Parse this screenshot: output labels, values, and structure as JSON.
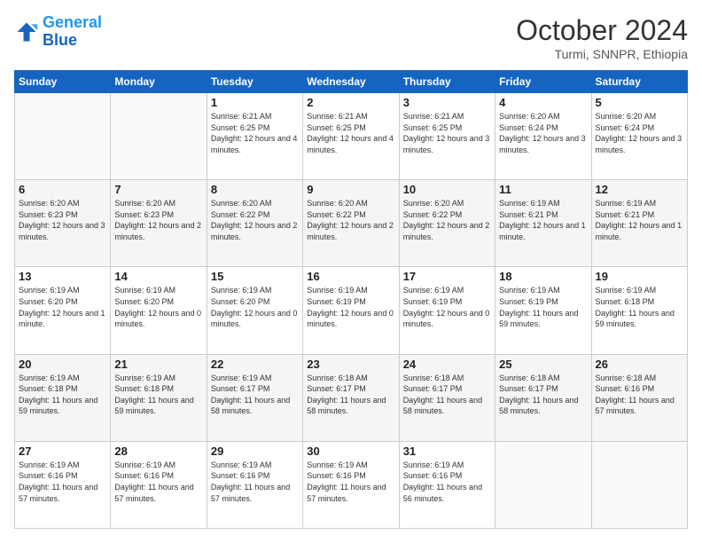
{
  "logo": {
    "line1": "General",
    "line2": "Blue"
  },
  "title": "October 2024",
  "location": "Turmi, SNNPR, Ethiopia",
  "weekdays": [
    "Sunday",
    "Monday",
    "Tuesday",
    "Wednesday",
    "Thursday",
    "Friday",
    "Saturday"
  ],
  "weeks": [
    [
      {
        "day": "",
        "info": ""
      },
      {
        "day": "",
        "info": ""
      },
      {
        "day": "1",
        "info": "Sunrise: 6:21 AM\nSunset: 6:25 PM\nDaylight: 12 hours\nand 4 minutes."
      },
      {
        "day": "2",
        "info": "Sunrise: 6:21 AM\nSunset: 6:25 PM\nDaylight: 12 hours\nand 4 minutes."
      },
      {
        "day": "3",
        "info": "Sunrise: 6:21 AM\nSunset: 6:25 PM\nDaylight: 12 hours\nand 3 minutes."
      },
      {
        "day": "4",
        "info": "Sunrise: 6:20 AM\nSunset: 6:24 PM\nDaylight: 12 hours\nand 3 minutes."
      },
      {
        "day": "5",
        "info": "Sunrise: 6:20 AM\nSunset: 6:24 PM\nDaylight: 12 hours\nand 3 minutes."
      }
    ],
    [
      {
        "day": "6",
        "info": "Sunrise: 6:20 AM\nSunset: 6:23 PM\nDaylight: 12 hours\nand 3 minutes."
      },
      {
        "day": "7",
        "info": "Sunrise: 6:20 AM\nSunset: 6:23 PM\nDaylight: 12 hours\nand 2 minutes."
      },
      {
        "day": "8",
        "info": "Sunrise: 6:20 AM\nSunset: 6:22 PM\nDaylight: 12 hours\nand 2 minutes."
      },
      {
        "day": "9",
        "info": "Sunrise: 6:20 AM\nSunset: 6:22 PM\nDaylight: 12 hours\nand 2 minutes."
      },
      {
        "day": "10",
        "info": "Sunrise: 6:20 AM\nSunset: 6:22 PM\nDaylight: 12 hours\nand 2 minutes."
      },
      {
        "day": "11",
        "info": "Sunrise: 6:19 AM\nSunset: 6:21 PM\nDaylight: 12 hours\nand 1 minute."
      },
      {
        "day": "12",
        "info": "Sunrise: 6:19 AM\nSunset: 6:21 PM\nDaylight: 12 hours\nand 1 minute."
      }
    ],
    [
      {
        "day": "13",
        "info": "Sunrise: 6:19 AM\nSunset: 6:20 PM\nDaylight: 12 hours\nand 1 minute."
      },
      {
        "day": "14",
        "info": "Sunrise: 6:19 AM\nSunset: 6:20 PM\nDaylight: 12 hours\nand 0 minutes."
      },
      {
        "day": "15",
        "info": "Sunrise: 6:19 AM\nSunset: 6:20 PM\nDaylight: 12 hours\nand 0 minutes."
      },
      {
        "day": "16",
        "info": "Sunrise: 6:19 AM\nSunset: 6:19 PM\nDaylight: 12 hours\nand 0 minutes."
      },
      {
        "day": "17",
        "info": "Sunrise: 6:19 AM\nSunset: 6:19 PM\nDaylight: 12 hours\nand 0 minutes."
      },
      {
        "day": "18",
        "info": "Sunrise: 6:19 AM\nSunset: 6:19 PM\nDaylight: 11 hours\nand 59 minutes."
      },
      {
        "day": "19",
        "info": "Sunrise: 6:19 AM\nSunset: 6:18 PM\nDaylight: 11 hours\nand 59 minutes."
      }
    ],
    [
      {
        "day": "20",
        "info": "Sunrise: 6:19 AM\nSunset: 6:18 PM\nDaylight: 11 hours\nand 59 minutes."
      },
      {
        "day": "21",
        "info": "Sunrise: 6:19 AM\nSunset: 6:18 PM\nDaylight: 11 hours\nand 59 minutes."
      },
      {
        "day": "22",
        "info": "Sunrise: 6:19 AM\nSunset: 6:17 PM\nDaylight: 11 hours\nand 58 minutes."
      },
      {
        "day": "23",
        "info": "Sunrise: 6:18 AM\nSunset: 6:17 PM\nDaylight: 11 hours\nand 58 minutes."
      },
      {
        "day": "24",
        "info": "Sunrise: 6:18 AM\nSunset: 6:17 PM\nDaylight: 11 hours\nand 58 minutes."
      },
      {
        "day": "25",
        "info": "Sunrise: 6:18 AM\nSunset: 6:17 PM\nDaylight: 11 hours\nand 58 minutes."
      },
      {
        "day": "26",
        "info": "Sunrise: 6:18 AM\nSunset: 6:16 PM\nDaylight: 11 hours\nand 57 minutes."
      }
    ],
    [
      {
        "day": "27",
        "info": "Sunrise: 6:19 AM\nSunset: 6:16 PM\nDaylight: 11 hours\nand 57 minutes."
      },
      {
        "day": "28",
        "info": "Sunrise: 6:19 AM\nSunset: 6:16 PM\nDaylight: 11 hours\nand 57 minutes."
      },
      {
        "day": "29",
        "info": "Sunrise: 6:19 AM\nSunset: 6:16 PM\nDaylight: 11 hours\nand 57 minutes."
      },
      {
        "day": "30",
        "info": "Sunrise: 6:19 AM\nSunset: 6:16 PM\nDaylight: 11 hours\nand 57 minutes."
      },
      {
        "day": "31",
        "info": "Sunrise: 6:19 AM\nSunset: 6:16 PM\nDaylight: 11 hours\nand 56 minutes."
      },
      {
        "day": "",
        "info": ""
      },
      {
        "day": "",
        "info": ""
      }
    ]
  ]
}
